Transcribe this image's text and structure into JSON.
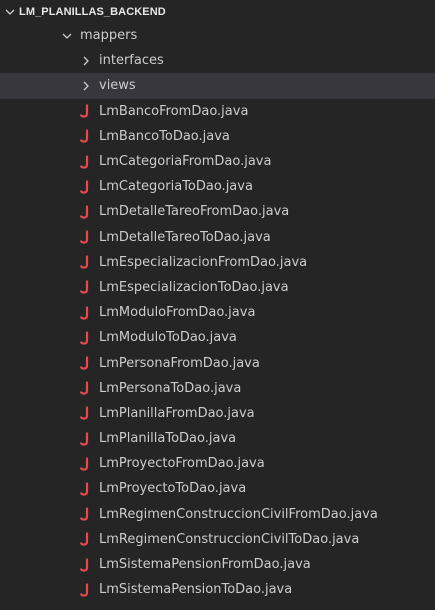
{
  "explorer": {
    "root_label": "LM_PLANILLAS_BACKEND",
    "folder": {
      "label": "mappers",
      "subfolders": [
        {
          "label": "interfaces"
        },
        {
          "label": "views"
        }
      ]
    },
    "files": [
      {
        "label": "LmBancoFromDao.java"
      },
      {
        "label": "LmBancoToDao.java"
      },
      {
        "label": "LmCategoriaFromDao.java"
      },
      {
        "label": "LmCategoriaToDao.java"
      },
      {
        "label": "LmDetalleTareoFromDao.java"
      },
      {
        "label": "LmDetalleTareoToDao.java"
      },
      {
        "label": "LmEspecializacionFromDao.java"
      },
      {
        "label": "LmEspecializacionToDao.java"
      },
      {
        "label": "LmModuloFromDao.java"
      },
      {
        "label": "LmModuloToDao.java"
      },
      {
        "label": "LmPersonaFromDao.java"
      },
      {
        "label": "LmPersonaToDao.java"
      },
      {
        "label": "LmPlanillaFromDao.java"
      },
      {
        "label": "LmPlanillaToDao.java"
      },
      {
        "label": "LmProyectoFromDao.java"
      },
      {
        "label": "LmProyectoToDao.java"
      },
      {
        "label": "LmRegimenConstruccionCivilFromDao.java"
      },
      {
        "label": "LmRegimenConstruccionCivilToDao.java"
      },
      {
        "label": "LmSistemaPensionFromDao.java"
      },
      {
        "label": "LmSistemaPensionToDao.java"
      }
    ],
    "selected_item": "views",
    "colors": {
      "background": "#252526",
      "selected_row": "#37373d",
      "text": "#cccccc",
      "java_icon": "#e5484d"
    }
  }
}
